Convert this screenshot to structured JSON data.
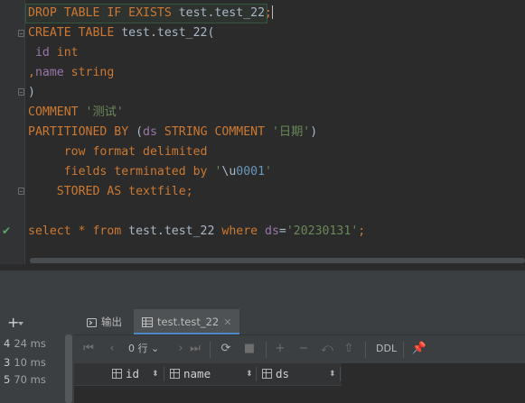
{
  "editor": {
    "lines": [
      {
        "segments": [
          {
            "t": "DROP TABLE IF EXISTS ",
            "c": "kw"
          },
          {
            "t": "test.test_22",
            "c": "pl"
          },
          {
            "t": ";",
            "c": "kw"
          }
        ]
      },
      {
        "segments": [
          {
            "t": "CREATE TABLE ",
            "c": "kw"
          },
          {
            "t": "test.test_22(",
            "c": "pl"
          }
        ]
      },
      {
        "segments": [
          {
            "t": " id ",
            "c": "fld"
          },
          {
            "t": "int",
            "c": "kw"
          }
        ]
      },
      {
        "segments": [
          {
            "t": ",",
            "c": "kw"
          },
          {
            "t": "name ",
            "c": "fld"
          },
          {
            "t": "string",
            "c": "kw"
          }
        ]
      },
      {
        "segments": [
          {
            "t": ")",
            "c": "pl"
          }
        ]
      },
      {
        "segments": [
          {
            "t": "COMMENT ",
            "c": "kw"
          },
          {
            "t": "'测试'",
            "c": "str"
          }
        ]
      },
      {
        "segments": [
          {
            "t": "PARTITIONED BY ",
            "c": "kw"
          },
          {
            "t": "(",
            "c": "pl"
          },
          {
            "t": "ds ",
            "c": "fld"
          },
          {
            "t": "STRING COMMENT ",
            "c": "kw"
          },
          {
            "t": "'日期'",
            "c": "str"
          },
          {
            "t": ")",
            "c": "pl"
          }
        ]
      },
      {
        "segments": [
          {
            "t": "     row format delimited",
            "c": "kw"
          }
        ]
      },
      {
        "segments": [
          {
            "t": "     fields terminated by ",
            "c": "kw"
          },
          {
            "t": "'",
            "c": "str"
          },
          {
            "t": "\\u",
            "c": "pl"
          },
          {
            "t": "0001",
            "c": "num"
          },
          {
            "t": "'",
            "c": "str"
          }
        ]
      },
      {
        "segments": [
          {
            "t": "    STORED AS textfile;",
            "c": "kw"
          }
        ]
      },
      {
        "segments": []
      },
      {
        "segments": [
          {
            "t": "select * from ",
            "c": "kw"
          },
          {
            "t": "test.test_22 ",
            "c": "pl"
          },
          {
            "t": "where ",
            "c": "kw"
          },
          {
            "t": "ds",
            "c": "fld"
          },
          {
            "t": "=",
            "c": "pl"
          },
          {
            "t": "'20230131'",
            "c": "str"
          },
          {
            "t": ";",
            "c": "kw"
          }
        ]
      }
    ]
  },
  "history": [
    {
      "index": "4",
      "time": "24 ms"
    },
    {
      "index": "3",
      "time": "10 ms"
    },
    {
      "index": "5",
      "time": "70 ms"
    }
  ],
  "tabs": {
    "output_label": "输出",
    "result_label": "test.test_22",
    "close_glyph": "✕"
  },
  "toolbar": {
    "rows_label": "0 行",
    "ddl_label": "DDL"
  },
  "columns": [
    {
      "name": "id"
    },
    {
      "name": "name"
    },
    {
      "name": "ds"
    }
  ],
  "colors": {
    "keyword": "#cc7832",
    "string": "#6a8759",
    "field": "#9876aa",
    "number": "#6897bb",
    "accent": "#4a88c7",
    "success": "#59a869"
  }
}
